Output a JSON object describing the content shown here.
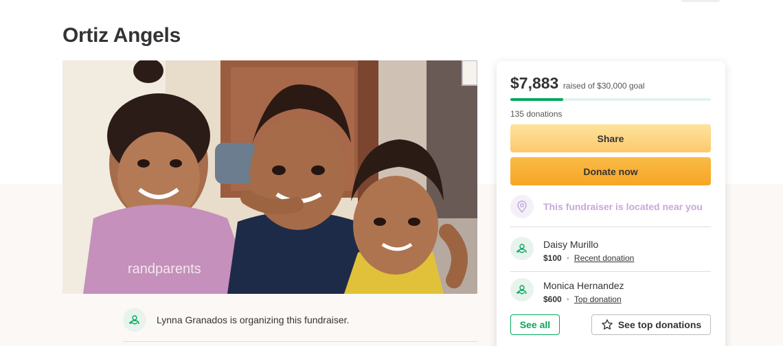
{
  "campaign": {
    "title": "Ortiz Angels",
    "photo_icon": "photo-of-three-children"
  },
  "organizer": {
    "text": "Lynna Granados is organizing this fundraiser.",
    "icon": "heart-hand-icon"
  },
  "donation_panel": {
    "amount_raised": "$7,883",
    "goal_text": "raised of $30,000 goal",
    "progress_fraction": 0.2628,
    "donations_count": "135 donations",
    "share_label": "Share",
    "donate_label": "Donate now",
    "location_text": "This fundraiser is located near you",
    "location_icon": "map-pin-icon",
    "donors": [
      {
        "name": "Daisy Murillo",
        "amount": "$100",
        "tag": "Recent donation"
      },
      {
        "name": "Monica Hernandez",
        "amount": "$600",
        "tag": "Top donation"
      }
    ],
    "see_all_label": "See all",
    "see_top_label": "See top donations",
    "see_top_icon": "star-outline-icon"
  },
  "colors": {
    "accent_green": "#02a95c",
    "share_yellow": "#fdc96c",
    "donate_orange": "#f7a624",
    "location_purple": "#c5a9dc"
  }
}
